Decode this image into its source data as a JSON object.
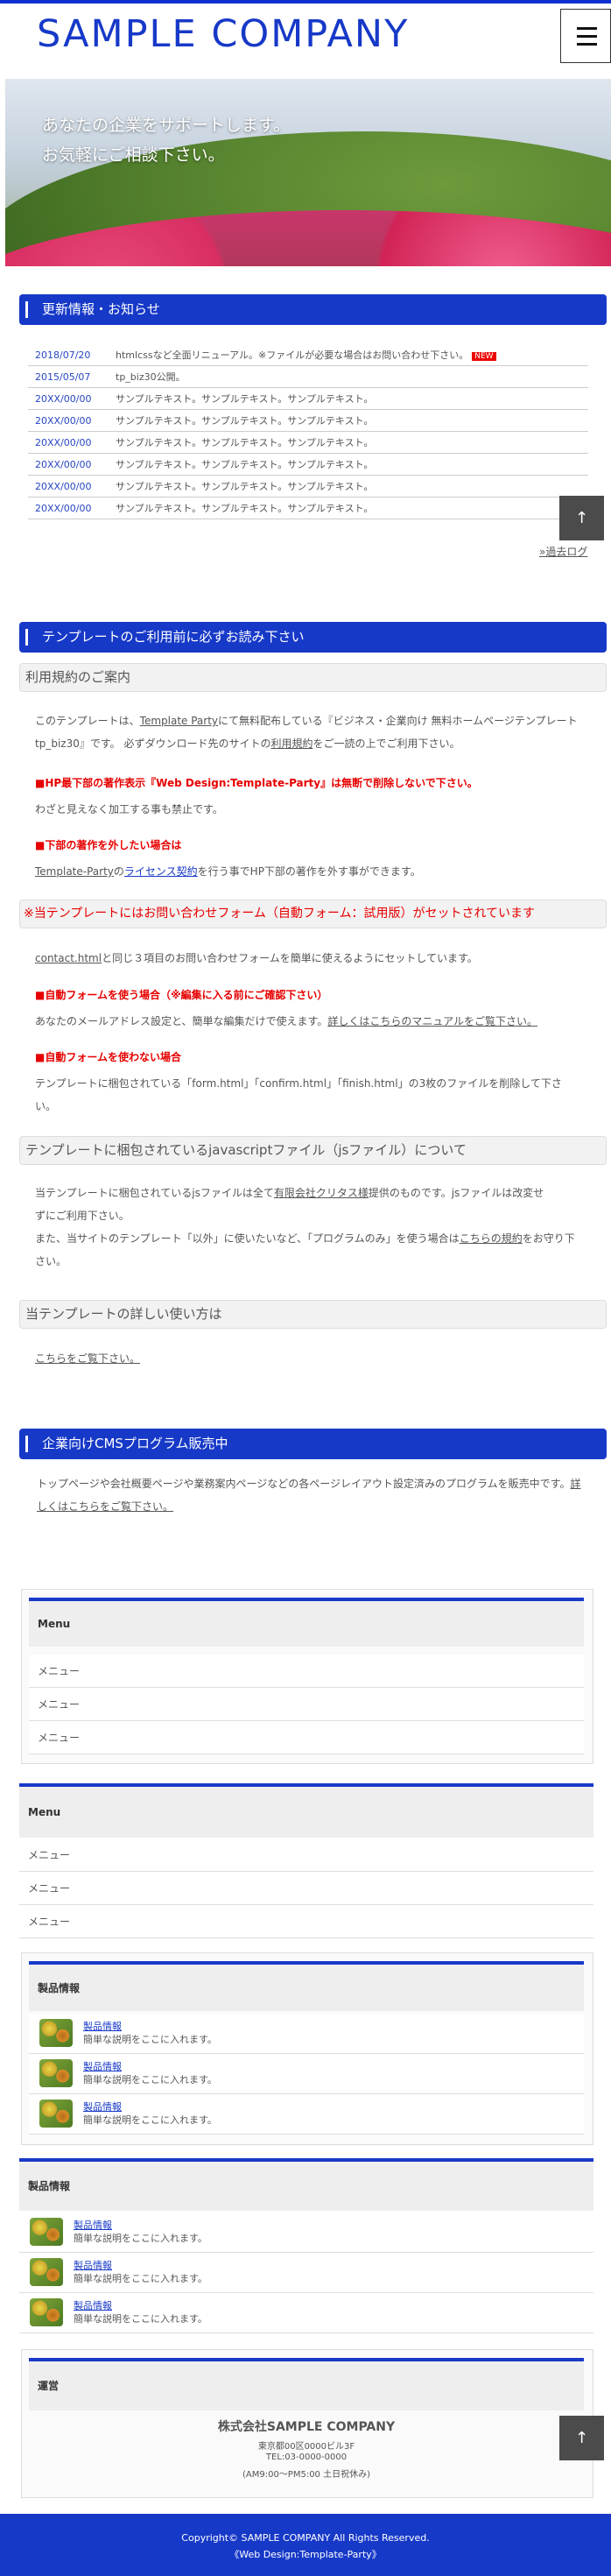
{
  "header": {
    "logo": "SAMPLE COMPANY"
  },
  "hero": {
    "line1": "あなたの企業をサポートします。",
    "line2": "お気軽にご相談下さい。"
  },
  "news": {
    "title": "更新情報・お知らせ",
    "items": [
      {
        "date": "2018/07/20",
        "text": "htmlcssなど全面リニューアル。※ファイルが必要な場合はお問い合わせ下さい。",
        "badge": "NEW"
      },
      {
        "date": "2015/05/07",
        "text": "tp_biz30公開。"
      },
      {
        "date": "20XX/00/00",
        "text": "サンプルテキスト。サンプルテキスト。サンプルテキスト。"
      },
      {
        "date": "20XX/00/00",
        "text": "サンプルテキスト。サンプルテキスト。サンプルテキスト。"
      },
      {
        "date": "20XX/00/00",
        "text": "サンプルテキスト。サンプルテキスト。サンプルテキスト。"
      },
      {
        "date": "20XX/00/00",
        "text": "サンプルテキスト。サンプルテキスト。サンプルテキスト。"
      },
      {
        "date": "20XX/00/00",
        "text": "サンプルテキスト。サンプルテキスト。サンプルテキスト。"
      },
      {
        "date": "20XX/00/00",
        "text": "サンプルテキスト。サンプルテキスト。サンプルテキスト。"
      }
    ],
    "past_log": "»過去ログ"
  },
  "terms": {
    "title": "テンプレートのご利用前に必ずお読み下さい",
    "sub1": "利用規約のご案内",
    "p1a": "このテンプレートは、",
    "p1link": "Template Party",
    "p1b": "にて無料配布している『ビジネス・企業向け 無料ホームページテンプレート",
    "p1c": "tp_biz30』です。 必ずダウンロード先のサイトの",
    "p1link2": "利用規約",
    "p1d": "をご一読の上でご利用下さい。",
    "red1": "■HP最下部の著作表示『Web Design:Template-Party』は無断で削除しないで下さい。",
    "p2": "わざと見えなく加工する事も禁止です。",
    "red2": "■下部の著作を外したい場合は",
    "p3link": "Template-Party",
    "p3mid": "の",
    "p3link2": "ライセンス契約",
    "p3b": "を行う事でHP下部の著作を外す事ができます。",
    "sub2": "※当テンプレートにはお問い合わせフォーム（自動フォーム：試用版）がセットされています",
    "p4link": "contact.html",
    "p4b": "と同じ３項目のお問い合わせフォームを簡単に使えるようにセットしています。",
    "red3": "■自動フォームを使う場合（※編集に入る前にご確認下さい）",
    "p5a": "あなたのメールアドレス設定と、簡単な編集だけで使えます。",
    "p5link": "詳しくはこちらのマニュアルをご覧下さい。",
    "red4": "■自動フォームを使わない場合",
    "p6a": "テンプレートに梱包されている「form.html」「confirm.html」「finish.html」の3枚のファイルを削除して下さ",
    "p6b": "い。",
    "sub3": "テンプレートに梱包されているjavascriptファイル（jsファイル）について",
    "p7a": "当テンプレートに梱包されているjsファイルは全て",
    "p7link": "有限会社クリタス様",
    "p7b": "提供のものです。jsファイルは改変せ",
    "p7c": "ずにご利用下さい。",
    "p7d": "また、当サイトのテンプレート「以外」に使いたいなど、「プログラムのみ」を使う場合は",
    "p7link2": "こちらの規約",
    "p7e": "をお守り下",
    "p7f": "さい。",
    "sub4": "当テンプレートの詳しい使い方は",
    "p8link": "こちらをご覧下さい。"
  },
  "cms": {
    "title": "企業向けCMSプログラム販売中",
    "p1": "トップページや会社概要ページや業務案内ページなどの各ページレイアウト設定済みのプログラムを販売中です。",
    "link1": "詳",
    "link2": "しくはこちらをご覧下さい。"
  },
  "menu1": {
    "head": "Menu",
    "items": [
      "メニュー",
      "メニュー",
      "メニュー"
    ]
  },
  "menu2": {
    "head": "Menu",
    "items": [
      "メニュー",
      "メニュー",
      "メニュー"
    ]
  },
  "products1": {
    "head": "製品情報",
    "items": [
      {
        "title": "製品情報",
        "desc": "簡単な説明をここに入れます。"
      },
      {
        "title": "製品情報",
        "desc": "簡単な説明をここに入れます。"
      },
      {
        "title": "製品情報",
        "desc": "簡単な説明をここに入れます。"
      }
    ]
  },
  "products2": {
    "head": "製品情報",
    "items": [
      {
        "title": "製品情報",
        "desc": "簡単な説明をここに入れます。"
      },
      {
        "title": "製品情報",
        "desc": "簡単な説明をここに入れます。"
      },
      {
        "title": "製品情報",
        "desc": "簡単な説明をここに入れます。"
      }
    ]
  },
  "company": {
    "head": "運営",
    "name": "株式会社SAMPLE COMPANY",
    "addr": "東京都00区0000ビル3F",
    "tel": "TEL:03-0000-0000",
    "hours": "(AM9:00〜PM5:00 土日祝休み)"
  },
  "footer": {
    "copyright": "Copyright© SAMPLE COMPANY All Rights Reserved.",
    "credit": "《Web Design:Template-Party》"
  },
  "totop_label": "↑",
  "colors": {
    "brand": "#1739c8",
    "alert": "#e60000"
  }
}
